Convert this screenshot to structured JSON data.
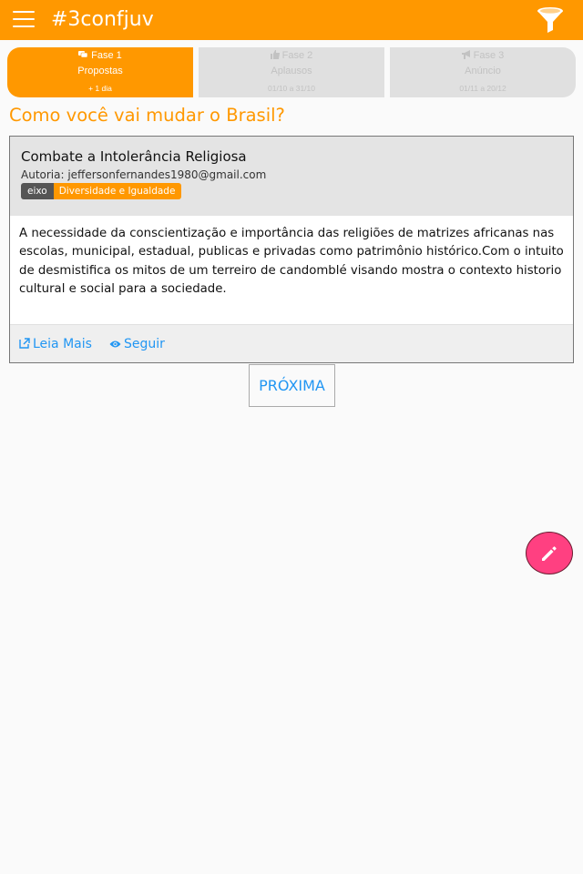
{
  "app": {
    "title": "#3confjuv"
  },
  "icons": {
    "menu": "hamburger-menu-icon",
    "filter": "funnel-filter-icon",
    "edit": "pencil-icon"
  },
  "colors": {
    "primary": "#ff9800",
    "accent": "#ff4081",
    "link": "#2196f3",
    "inactive": "#e0e0e0"
  },
  "phases": [
    {
      "name": "Fase 1",
      "label": "Propostas",
      "date": "+ 1 dia",
      "active": true,
      "icon": "comments-icon"
    },
    {
      "name": "Fase 2",
      "label": "Aplausos",
      "date": "01/10 a 31/10",
      "active": false,
      "icon": "thumbs-up-icon"
    },
    {
      "name": "Fase 3",
      "label": "Anúncio",
      "date": "01/11 a 20/12",
      "active": false,
      "icon": "bullhorn-icon"
    }
  ],
  "question": "Como você vai mudar o Brasil?",
  "proposal": {
    "title": "Combate a Intolerância Religiosa",
    "author": "Autoria: jeffersonfernandes1980@gmail.com",
    "tag_label": "eixo",
    "tag_value": "Diversidade e Igualdade",
    "body": "A necessidade da conscientização e importância das religiões de matrizes africanas nas escolas, municipal, estadual, publicas e privadas como patrimônio histórico.Com o intuito de desmistifica os mitos de um terreiro de candomblé visando mostra o contexto historio cultural e social para a sociedade.",
    "read_more": "Leia Mais",
    "follow": "Seguir"
  },
  "next_button": "PRÓXIMA"
}
